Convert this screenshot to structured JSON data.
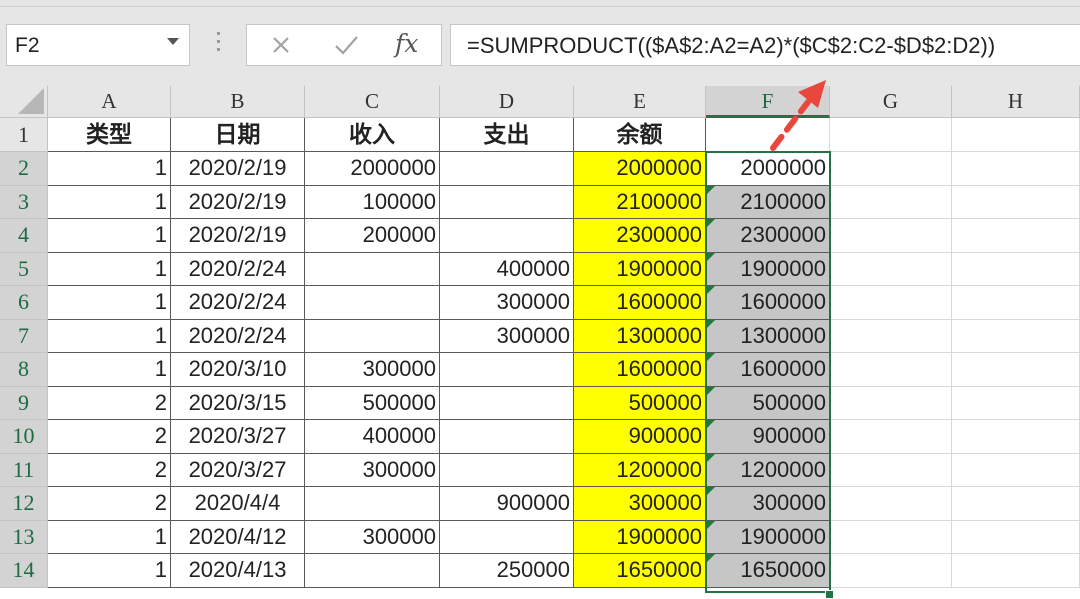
{
  "name_box": {
    "value": "F2"
  },
  "formula_bar": {
    "formula": "=SUMPRODUCT(($A$2:A2=A2)*($C$2:C2-$D$2:D2))",
    "insert_function_label": "fx"
  },
  "sheet": {
    "columns": [
      "A",
      "B",
      "C",
      "D",
      "E",
      "F",
      "G",
      "H"
    ],
    "active_column": "F",
    "active_cell": "F2",
    "header_row": [
      "类型",
      "日期",
      "收入",
      "支出",
      "余额",
      ""
    ],
    "rows": [
      {
        "num": "2",
        "cells": [
          "1",
          "2020/2/19",
          "2000000",
          "",
          "2000000",
          "2000000"
        ]
      },
      {
        "num": "3",
        "cells": [
          "1",
          "2020/2/19",
          "100000",
          "",
          "2100000",
          "2100000"
        ]
      },
      {
        "num": "4",
        "cells": [
          "1",
          "2020/2/19",
          "200000",
          "",
          "2300000",
          "2300000"
        ]
      },
      {
        "num": "5",
        "cells": [
          "1",
          "2020/2/24",
          "",
          "400000",
          "1900000",
          "1900000"
        ]
      },
      {
        "num": "6",
        "cells": [
          "1",
          "2020/2/24",
          "",
          "300000",
          "1600000",
          "1600000"
        ]
      },
      {
        "num": "7",
        "cells": [
          "1",
          "2020/2/24",
          "",
          "300000",
          "1300000",
          "1300000"
        ]
      },
      {
        "num": "8",
        "cells": [
          "1",
          "2020/3/10",
          "300000",
          "",
          "1600000",
          "1600000"
        ]
      },
      {
        "num": "9",
        "cells": [
          "2",
          "2020/3/15",
          "500000",
          "",
          "500000",
          "500000"
        ]
      },
      {
        "num": "10",
        "cells": [
          "2",
          "2020/3/27",
          "400000",
          "",
          "900000",
          "900000"
        ]
      },
      {
        "num": "11",
        "cells": [
          "2",
          "2020/3/27",
          "300000",
          "",
          "1200000",
          "1200000"
        ]
      },
      {
        "num": "12",
        "cells": [
          "2",
          "2020/4/4",
          "",
          "900000",
          "300000",
          "300000"
        ]
      },
      {
        "num": "13",
        "cells": [
          "1",
          "2020/4/12",
          "300000",
          "",
          "1900000",
          "1900000"
        ]
      },
      {
        "num": "14",
        "cells": [
          "1",
          "2020/4/13",
          "",
          "250000",
          "1650000",
          "1650000"
        ]
      }
    ]
  },
  "colors": {
    "highlight_yellow": "#ffff00",
    "selection_gray": "#c6c6c6",
    "excel_green": "#217346",
    "annotation_red": "#e8473d"
  }
}
